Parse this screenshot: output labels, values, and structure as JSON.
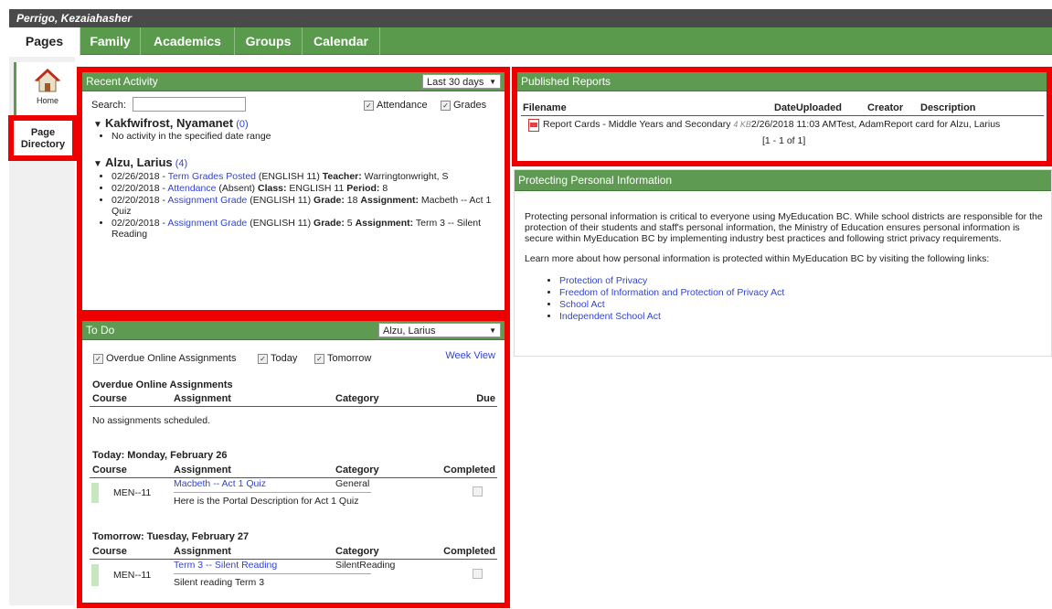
{
  "user": {
    "name": "Perrigo, Kezaiahasher"
  },
  "tabs": [
    {
      "label": "Pages",
      "active": true
    },
    {
      "label": "Family"
    },
    {
      "label": "Academics"
    },
    {
      "label": "Groups"
    },
    {
      "label": "Calendar"
    }
  ],
  "leftnav": {
    "home": "Home",
    "page_directory_1": "Page",
    "page_directory_2": "Directory"
  },
  "recent": {
    "title": "Recent Activity",
    "range": "Last 30 days",
    "search_label": "Search:",
    "search_value": "",
    "attendance_label": "Attendance",
    "grades_label": "Grades",
    "students": [
      {
        "name": "Kakfwifrost, Nyamanet",
        "count": "(0)",
        "items": [
          "No activity in the specified date range"
        ]
      },
      {
        "name": "Alzu, Larius",
        "count": "(4)",
        "items": [
          {
            "date": "02/26/2018 - ",
            "link": "Term Grades Posted",
            "rest1": " (ENGLISH 11) ",
            "b1": "Teacher:",
            "rest2": " Warringtonwright, S"
          },
          {
            "date": "02/20/2018 - ",
            "link": "Attendance",
            "rest1": " (Absent) ",
            "b1": "Class:",
            "rest2": " ENGLISH 11 ",
            "b2": "Period:",
            "rest3": " 8"
          },
          {
            "date": "02/20/2018 - ",
            "link": "Assignment Grade",
            "rest1": " (ENGLISH 11) ",
            "b1": "Grade:",
            "rest2": " 18 ",
            "b2": "Assignment:",
            "rest3": " Macbeth -- Act 1 Quiz"
          },
          {
            "date": "02/20/2018 - ",
            "link": "Assignment Grade",
            "rest1": " (ENGLISH 11) ",
            "b1": "Grade:",
            "rest2": " 5 ",
            "b2": "Assignment:",
            "rest3": " Term 3 -- Silent Reading"
          }
        ]
      }
    ]
  },
  "todo": {
    "title": "To Do",
    "student": "Alzu, Larius",
    "chk_overdue": "Overdue Online Assignments",
    "chk_today": "Today",
    "chk_tomorrow": "Tomorrow",
    "week_view": "Week View",
    "overdue": {
      "heading": "Overdue Online Assignments",
      "cols": [
        "Course",
        "Assignment",
        "Category",
        "Due"
      ],
      "empty": "No assignments scheduled."
    },
    "today": {
      "heading": "Today: Monday, February 26",
      "cols": [
        "Course",
        "Assignment",
        "Category",
        "Completed"
      ],
      "row": {
        "course": "MEN--11",
        "assignment": "Macbeth -- Act 1 Quiz",
        "category": "General",
        "desc": "Here is the Portal Description for Act 1 Quiz"
      }
    },
    "tomorrow": {
      "heading": "Tomorrow: Tuesday, February 27",
      "cols": [
        "Course",
        "Assignment",
        "Category",
        "Completed"
      ],
      "row": {
        "course": "MEN--11",
        "assignment": "Term 3 -- Silent Reading",
        "category": "SilentReading",
        "desc": "Silent reading Term 3"
      }
    }
  },
  "reports": {
    "title": "Published Reports",
    "cols": [
      "Filename",
      "DateUploaded",
      "Creator",
      "Description"
    ],
    "row": {
      "filename": "Report Cards - Middle Years and Secondary",
      "size": "4 KB",
      "date": "2/26/2018 11:03 AM",
      "creator": "Test, Adam",
      "description": "Report card for Alzu, Larius"
    },
    "pager": "[1 - 1 of 1]"
  },
  "privacy": {
    "title": "Protecting Personal Information",
    "para1": "Protecting personal information is critical to everyone using MyEducation BC. While school districts are responsible for the protection of their students and staff's personal information, the Ministry of Education ensures personal information is secure within MyEducation BC by implementing industry best practices and following strict privacy requirements.",
    "para2": "Learn more about how personal information is protected within MyEducation BC by visiting the following links:",
    "links": [
      "Protection of Privacy",
      "Freedom of Information and Protection of Privacy Act",
      "School Act",
      "Independent School Act"
    ]
  },
  "colors": {
    "green": "#5f9a53",
    "highlight": "#ee0000",
    "topbar": "#4a4a4a"
  }
}
